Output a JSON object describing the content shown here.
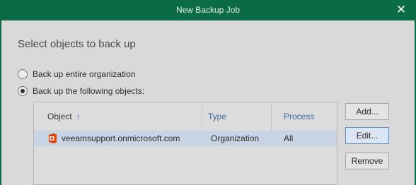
{
  "window": {
    "title": "New Backup Job",
    "close_glyph": "✕"
  },
  "page": {
    "heading": "Select objects to back up"
  },
  "options": {
    "entire_org_label": "Back up entire organization",
    "following_objects_label": "Back up the following objects:",
    "selected": "following_objects"
  },
  "table": {
    "columns": {
      "object": "Object",
      "object_sort_glyph": "↑",
      "type": "Type",
      "process": "Process"
    },
    "rows": [
      {
        "icon": "office365-icon",
        "object": "veeamsupport.onmicrosoft.com",
        "type": "Organization",
        "process": "All",
        "selected": true
      }
    ]
  },
  "buttons": {
    "add": "Add...",
    "edit": "Edit...",
    "remove": "Remove"
  },
  "colors": {
    "titlebar": "#0a6b45",
    "row_selected": "#c8d4e3",
    "header_link": "#3a6aa0"
  }
}
